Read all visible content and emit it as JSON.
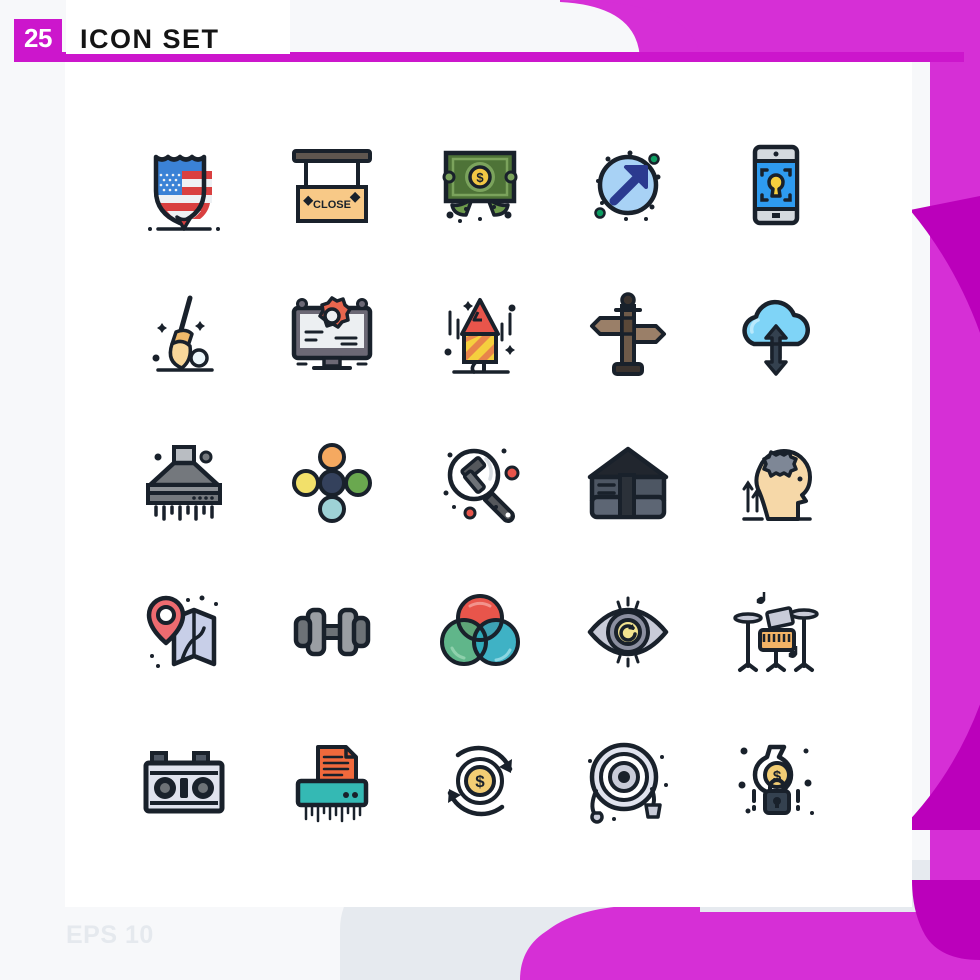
{
  "header": {
    "count_badge": "25",
    "title": "ICON SET",
    "badge_color": "#cc16cc",
    "title_color": "#141414"
  },
  "footer": {
    "format_label": "EPS 10",
    "color": "#e5e9ee"
  },
  "theme": {
    "page_background": "#f7f8fa",
    "panel_background": "#ffffff",
    "accent_magenta": "#cc16cc",
    "accent_magenta_light": "#d62fd6",
    "accent_magenta_dark": "#bb00bb",
    "decor_gray": "#e3e8ec"
  },
  "grid": {
    "columns": 5,
    "rows": 5,
    "total_icons": 25,
    "icons": [
      {
        "row": 1,
        "col": 1,
        "name": "police-badge-usa-shield-icon",
        "label": "USA Shield Badge"
      },
      {
        "row": 1,
        "col": 2,
        "name": "close-sign-board-icon",
        "label": "Close Sign Board",
        "text": "CLOSE"
      },
      {
        "row": 1,
        "col": 3,
        "name": "money-dollar-bill-icon",
        "label": "Dollar Bill",
        "text": "$"
      },
      {
        "row": 1,
        "col": 4,
        "name": "arrow-up-right-circle-icon",
        "label": "Growth Arrow"
      },
      {
        "row": 1,
        "col": 5,
        "name": "mobile-security-lock-icon",
        "label": "Mobile Security"
      },
      {
        "row": 2,
        "col": 1,
        "name": "cleaning-broom-icon",
        "label": "Broom"
      },
      {
        "row": 2,
        "col": 2,
        "name": "monitor-settings-gear-icon",
        "label": "Monitor Settings"
      },
      {
        "row": 2,
        "col": 3,
        "name": "firework-rocket-icon",
        "label": "Firework Rocket"
      },
      {
        "row": 2,
        "col": 4,
        "name": "signpost-direction-icon",
        "label": "Signpost"
      },
      {
        "row": 2,
        "col": 5,
        "name": "cloud-data-transfer-icon",
        "label": "Cloud Upload Download"
      },
      {
        "row": 3,
        "col": 1,
        "name": "kitchen-extractor-hood-icon",
        "label": "Extractor Hood"
      },
      {
        "row": 3,
        "col": 2,
        "name": "molecule-network-icon",
        "label": "Molecule Network"
      },
      {
        "row": 3,
        "col": 3,
        "name": "law-search-gavel-icon",
        "label": "Law Search"
      },
      {
        "row": 3,
        "col": 4,
        "name": "envelope-mail-open-icon",
        "label": "Open Mail"
      },
      {
        "row": 3,
        "col": 5,
        "name": "brain-gear-thinking-icon",
        "label": "Brain Gear"
      },
      {
        "row": 4,
        "col": 1,
        "name": "map-location-pin-icon",
        "label": "Map Location"
      },
      {
        "row": 4,
        "col": 2,
        "name": "dumbbell-fitness-icon",
        "label": "Dumbbell"
      },
      {
        "row": 4,
        "col": 3,
        "name": "color-venn-circles-icon",
        "label": "Color Circles"
      },
      {
        "row": 4,
        "col": 4,
        "name": "eye-vision-icon",
        "label": "Eye Vision"
      },
      {
        "row": 4,
        "col": 5,
        "name": "drum-kit-music-icon",
        "label": "Drum Kit"
      },
      {
        "row": 5,
        "col": 1,
        "name": "car-battery-icon",
        "label": "Battery"
      },
      {
        "row": 5,
        "col": 2,
        "name": "paper-shredder-icon",
        "label": "Paper Shredder"
      },
      {
        "row": 5,
        "col": 3,
        "name": "money-refresh-cycle-icon",
        "label": "Money Cycle",
        "text": "$"
      },
      {
        "row": 5,
        "col": 4,
        "name": "fire-hose-reel-icon",
        "label": "Fire Hose"
      },
      {
        "row": 5,
        "col": 5,
        "name": "money-bag-lock-icon",
        "label": "Money Lock",
        "text": "$"
      }
    ]
  }
}
